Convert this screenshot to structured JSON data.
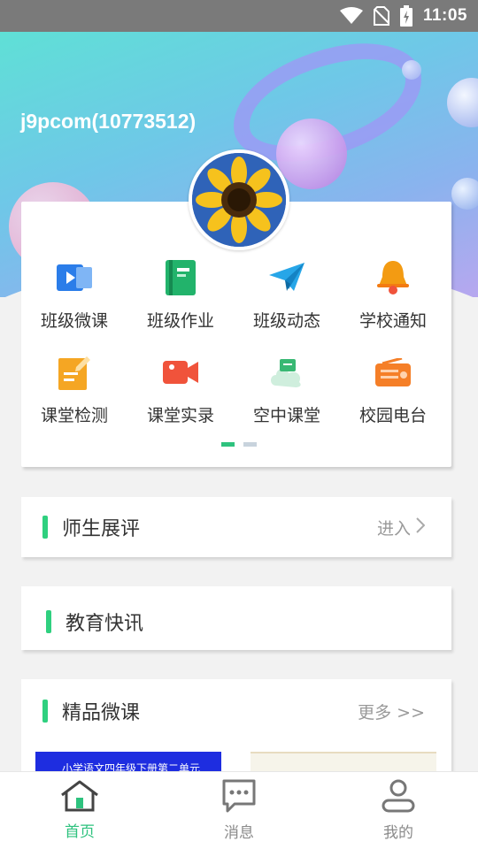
{
  "status_bar": {
    "time": "11:05",
    "icons": [
      "wifi-icon",
      "no-sim-icon",
      "battery-charging-icon"
    ]
  },
  "header": {
    "user_name": "j9pcom(10773512)",
    "avatar": "sunflower-avatar"
  },
  "menu": {
    "items": [
      {
        "label": "班级微课",
        "icon": "video-icon",
        "color": "#2b7de9"
      },
      {
        "label": "班级作业",
        "icon": "book-icon",
        "color": "#22b36b"
      },
      {
        "label": "班级动态",
        "icon": "paper-plane-icon",
        "color": "#27a6e8"
      },
      {
        "label": "学校通知",
        "icon": "bell-icon",
        "color": "#f39b12"
      },
      {
        "label": "课堂检测",
        "icon": "edit-document-icon",
        "color": "#f5a623"
      },
      {
        "label": "课堂实录",
        "icon": "camera-icon",
        "color": "#f0533b"
      },
      {
        "label": "空中课堂",
        "icon": "cloud-icon",
        "color": "#6ccf9b"
      },
      {
        "label": "校园电台",
        "icon": "radio-icon",
        "color": "#f57f28"
      }
    ],
    "page_indicator": {
      "pages": 2,
      "current": 1
    }
  },
  "sections": {
    "showcase": {
      "title": "师生展评",
      "more": "进入"
    },
    "news": {
      "title": "教育快讯"
    },
    "courses": {
      "title": "精品微课",
      "more": "更多 >>",
      "thumbs": [
        "小学语文四年级下册第二单元",
        ""
      ]
    }
  },
  "tabbar": {
    "tabs": [
      {
        "label": "首页",
        "icon": "home-icon",
        "active": true
      },
      {
        "label": "消息",
        "icon": "message-icon",
        "active": false
      },
      {
        "label": "我的",
        "icon": "user-icon",
        "active": false
      }
    ]
  },
  "colors": {
    "accent": "#2ec27e"
  }
}
